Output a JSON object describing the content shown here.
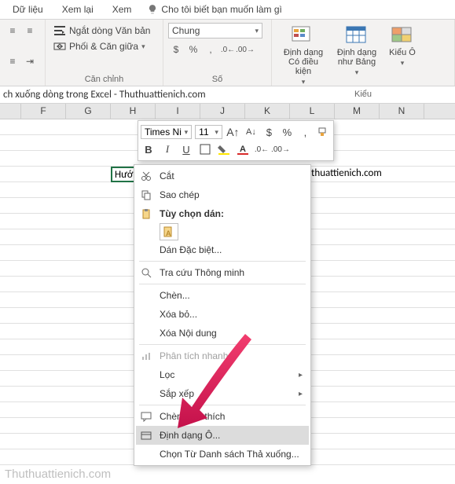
{
  "tabs": {
    "data": "Dữ liệu",
    "review": "Xem lại",
    "view": "Xem",
    "tellme": "Cho tôi biết bạn muốn làm gì"
  },
  "ribbon": {
    "wrap": "Ngắt dòng Văn bản",
    "merge": "Phối & Căn giữa",
    "alignment_label": "Căn chỉnh",
    "number_format": "Chung",
    "number_label": "Số",
    "cond_format": "Định dạng Có điều kiện",
    "as_table": "Định dạng như Bảng",
    "cell_styles": "Kiểu Ô",
    "styles_label": "Kiểu"
  },
  "formula_bar": "ch xuống dòng trong Excel - Thuthuattienich.com",
  "columns": [
    "",
    "F",
    "G",
    "H",
    "I",
    "J",
    "K",
    "L",
    "M",
    "N"
  ],
  "cell_value": "Hướng",
  "cell_right": "thuthuattienich.com",
  "mini": {
    "font": "Times Ni",
    "size": "11",
    "currency": "$",
    "percent": "%",
    "comma": ",",
    "bold": "B",
    "italic": "I"
  },
  "menu": {
    "cut": "Cắt",
    "copy": "Sao chép",
    "paste_options": "Tùy chọn dán:",
    "paste_special": "Dán Đặc biệt...",
    "smart_lookup": "Tra cứu Thông minh",
    "insert": "Chèn...",
    "delete": "Xóa bỏ...",
    "clear": "Xóa Nội dung",
    "quick_analysis": "Phân tích nhanh",
    "filter": "Lọc",
    "sort": "Sắp xếp",
    "insert_comment": "Chèn Chú thích",
    "format_cells": "Định dạng Ô...",
    "dropdown": "Chọn Từ Danh sách Thả xuống..."
  },
  "char": {
    "chev": "▾",
    "tri": "▸",
    "u": "U",
    "a_big": "A",
    "a_sm": "A"
  },
  "watermark": "Thuthuattienich.com"
}
